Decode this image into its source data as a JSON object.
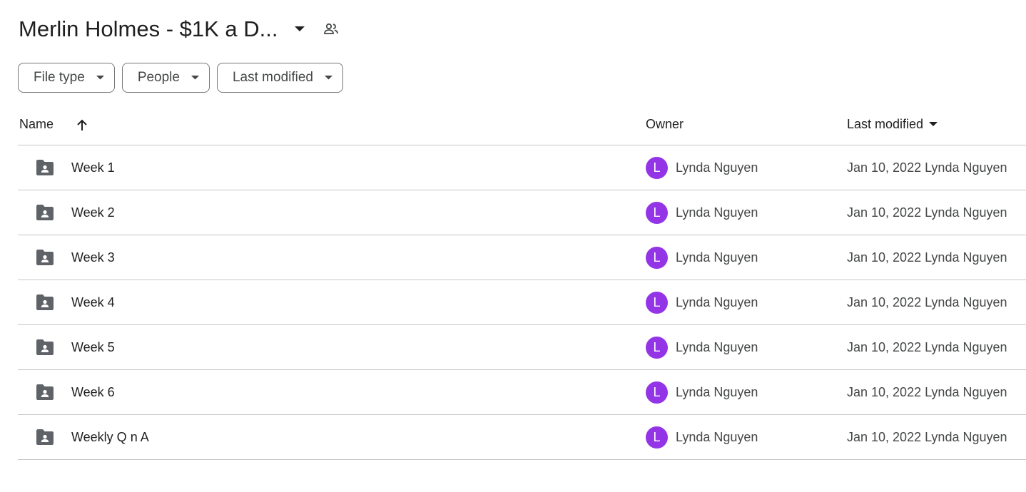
{
  "header": {
    "title": "Merlin Holmes - $1K a D...",
    "title_dropdown_icon": "caret-down-icon",
    "shared_icon": "people-icon"
  },
  "filters": [
    {
      "label": "File type"
    },
    {
      "label": "People"
    },
    {
      "label": "Last modified"
    }
  ],
  "table": {
    "columns": {
      "name": "Name",
      "owner": "Owner",
      "last_modified": "Last modified"
    },
    "sort_icon": "arrow-up-icon",
    "rows": [
      {
        "name": "Week 1",
        "owner_initial": "L",
        "owner": "Lynda Nguyen",
        "modified": "Jan 10, 2022 Lynda Nguyen"
      },
      {
        "name": "Week 2",
        "owner_initial": "L",
        "owner": "Lynda Nguyen",
        "modified": "Jan 10, 2022 Lynda Nguyen"
      },
      {
        "name": "Week 3",
        "owner_initial": "L",
        "owner": "Lynda Nguyen",
        "modified": "Jan 10, 2022 Lynda Nguyen"
      },
      {
        "name": "Week 4",
        "owner_initial": "L",
        "owner": "Lynda Nguyen",
        "modified": "Jan 10, 2022 Lynda Nguyen"
      },
      {
        "name": "Week 5",
        "owner_initial": "L",
        "owner": "Lynda Nguyen",
        "modified": "Jan 10, 2022 Lynda Nguyen"
      },
      {
        "name": "Week 6",
        "owner_initial": "L",
        "owner": "Lynda Nguyen",
        "modified": "Jan 10, 2022 Lynda Nguyen"
      },
      {
        "name": "Weekly Q n A",
        "owner_initial": "L",
        "owner": "Lynda Nguyen",
        "modified": "Jan 10, 2022 Lynda Nguyen"
      }
    ]
  },
  "colors": {
    "avatar": "#9334e6",
    "folder_icon": "#5f6368",
    "divider": "#c7c7c7"
  }
}
